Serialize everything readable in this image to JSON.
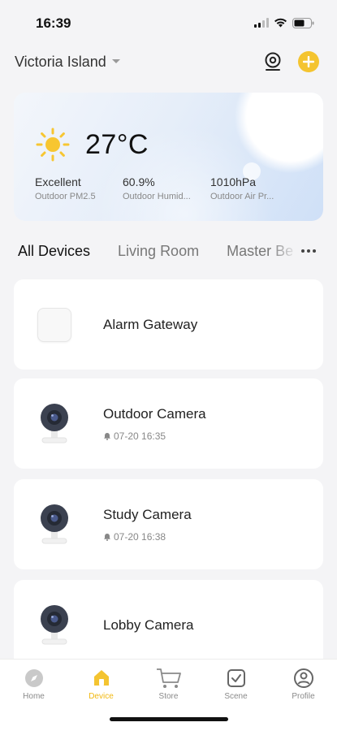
{
  "status_bar": {
    "time": "16:39"
  },
  "header": {
    "home_name": "Victoria Island"
  },
  "weather": {
    "temperature": "27°C",
    "stats": [
      {
        "value": "Excellent",
        "label": "Outdoor PM2.5"
      },
      {
        "value": "60.9%",
        "label": "Outdoor Humid..."
      },
      {
        "value": "1010hPa",
        "label": "Outdoor Air Pr..."
      }
    ]
  },
  "tabs": [
    {
      "label": "All Devices",
      "active": true
    },
    {
      "label": "Living Room",
      "active": false
    },
    {
      "label": "Master Be",
      "active": false
    }
  ],
  "devices": [
    {
      "name": "Alarm Gateway",
      "icon": "gateway-icon"
    },
    {
      "name": "Outdoor Camera",
      "icon": "camera-icon",
      "event_time": "07-20 16:35"
    },
    {
      "name": "Study Camera",
      "icon": "camera-icon",
      "event_time": "07-20 16:38"
    },
    {
      "name": "Lobby Camera",
      "icon": "camera-icon"
    }
  ],
  "tabbar": [
    {
      "label": "Home",
      "icon": "compass-icon",
      "active": false
    },
    {
      "label": "Device",
      "icon": "house-icon",
      "active": true
    },
    {
      "label": "Store",
      "icon": "cart-icon",
      "active": false
    },
    {
      "label": "Scene",
      "icon": "checkbox-icon",
      "active": false
    },
    {
      "label": "Profile",
      "icon": "person-icon",
      "active": false
    }
  ],
  "colors": {
    "accent": "#f4c430",
    "active_tab_label": "#f2b80f"
  }
}
